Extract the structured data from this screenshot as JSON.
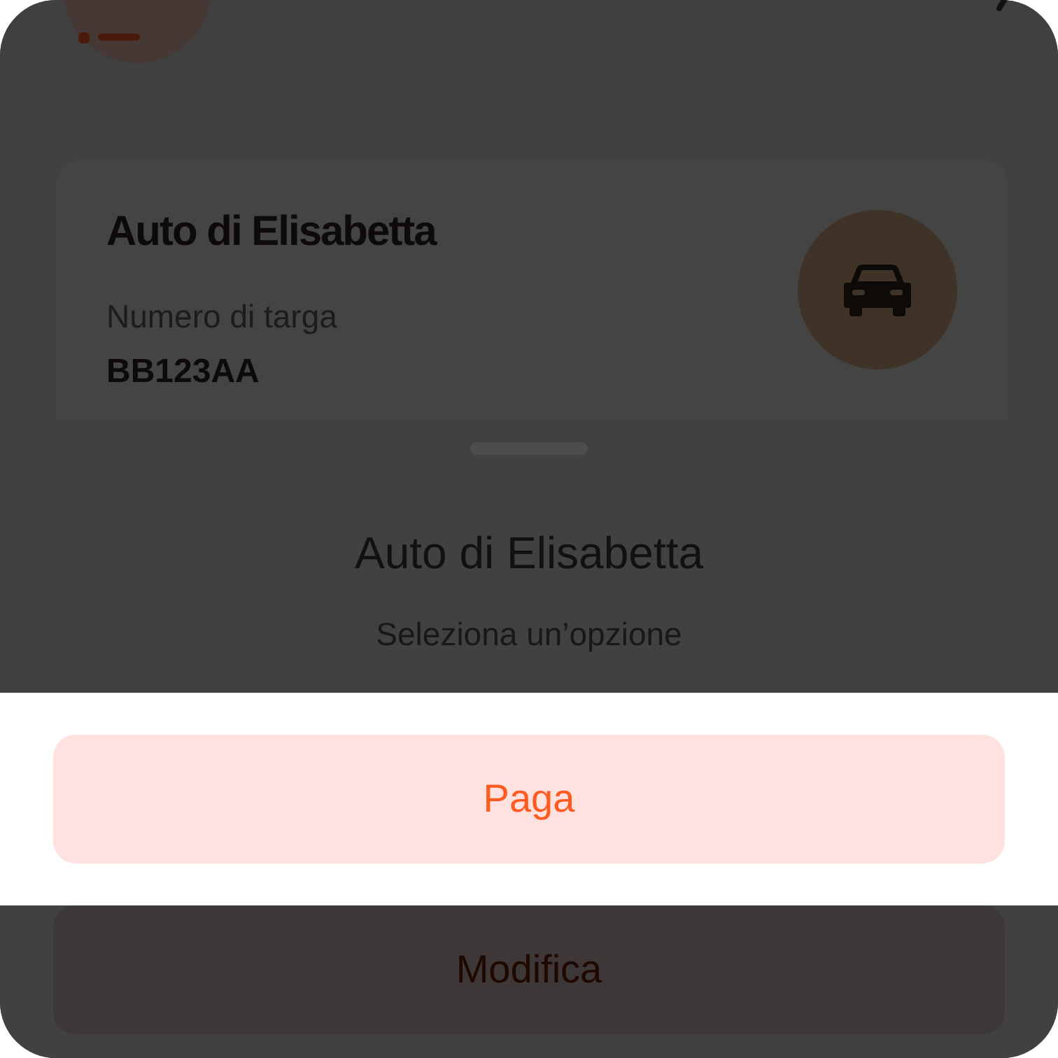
{
  "vehicle_card": {
    "title": "Auto di Elisabetta",
    "plate_label": "Numero di targa",
    "plate": "BB123AA"
  },
  "sheet": {
    "title": "Auto di Elisabetta",
    "subtitle": "Seleziona un’opzione",
    "options": [
      {
        "label": "Paga",
        "highlighted": true
      },
      {
        "label": "Modifica",
        "highlighted": false
      }
    ]
  }
}
